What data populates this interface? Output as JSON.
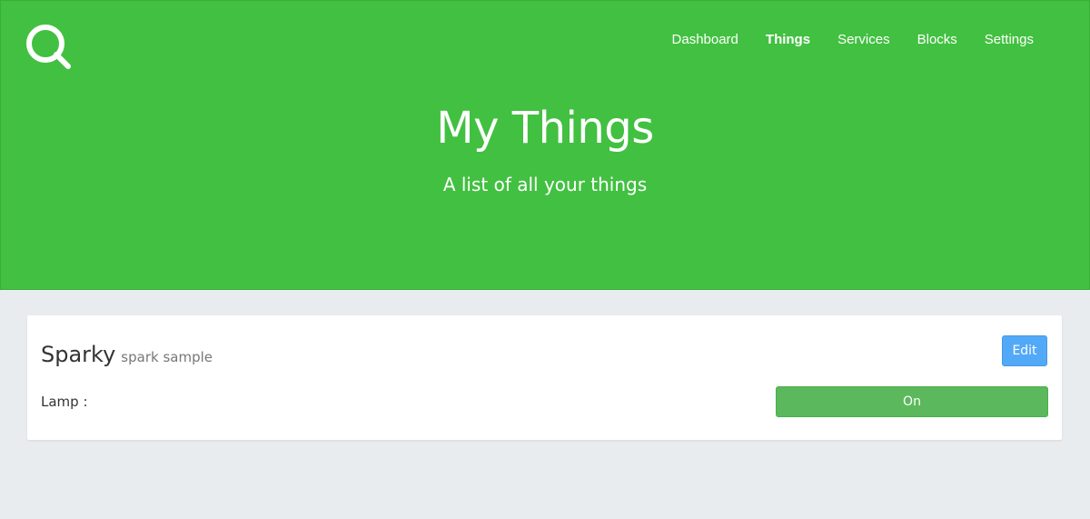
{
  "header": {
    "logo_icon": "search-icon",
    "nav": [
      {
        "label": "Dashboard",
        "active": false
      },
      {
        "label": "Things",
        "active": true
      },
      {
        "label": "Services",
        "active": false
      },
      {
        "label": "Blocks",
        "active": false
      },
      {
        "label": "Settings",
        "active": false
      }
    ],
    "title": "My Things",
    "subtitle": "A list of all your things"
  },
  "things": [
    {
      "name": "Sparky",
      "description": "spark sample",
      "edit_label": "Edit",
      "properties": [
        {
          "label": "Lamp :",
          "button_label": "On"
        }
      ]
    }
  ],
  "colors": {
    "hero": "#42c041",
    "background": "#e8ecef",
    "edit_button": "#52a9f8",
    "toggle_button": "#5cb85c"
  }
}
